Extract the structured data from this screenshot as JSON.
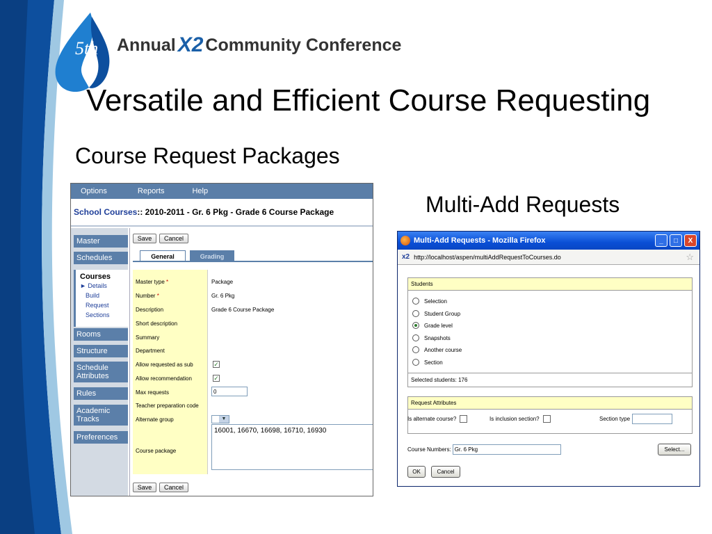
{
  "slide": {
    "logo_ordinal": "5th",
    "logo_text_left": "Annual",
    "logo_x2": "X2",
    "logo_text_right": "Community Conference",
    "title": "Versatile and Efficient Course Requesting",
    "left_heading": "Course Request Packages",
    "right_heading": "Multi-Add Requests"
  },
  "colors": {
    "nav_blue": "#5b7fa9",
    "label_yellow": "#ffffc4",
    "band_dark": "#0d4f9e",
    "band_light": "#9fc8e3"
  },
  "course_app": {
    "menu": [
      "Options",
      "Reports",
      "Help"
    ],
    "breadcrumb_link": "School Courses",
    "breadcrumb_rest": " :: 2010-2011 - Gr. 6 Pkg - Grade 6 Course Package",
    "nav": {
      "master": "Master",
      "schedules": "Schedules",
      "courses": "Courses",
      "courses_sub": [
        "► Details",
        "Build",
        "Request",
        "Sections"
      ],
      "rooms": "Rooms",
      "structure": "Structure",
      "schedule_attributes_1": "Schedule",
      "schedule_attributes_2": "Attributes",
      "rules": "Rules",
      "academic_tracks_1": "Academic",
      "academic_tracks_2": "Tracks",
      "preferences": "Preferences"
    },
    "save_label": "Save",
    "cancel_label": "Cancel",
    "tabs": [
      "General",
      "Grading"
    ],
    "fields": {
      "master_type_label": "Master type",
      "master_type_value": "Package",
      "number_label": "Number",
      "number_value": "Gr. 6 Pkg",
      "required_mark": "*",
      "description_label": "Description",
      "description_value": "Grade 6 Course Package",
      "short_description_label": "Short description",
      "summary_label": "Summary",
      "department_label": "Department",
      "allow_sub_label": "Allow requested as sub",
      "allow_recommendation_label": "Allow recommendation",
      "max_requests_label": "Max requests",
      "max_requests_value": "0",
      "teacher_prep_label": "Teacher preparation code",
      "alternate_group_label": "Alternate group",
      "course_package_label": "Course package",
      "course_package_value": "16001, 16670, 16698, 16710, 16930",
      "check_mark": "✓",
      "dropdown_arrow": "▼"
    }
  },
  "multi_add": {
    "window_title": "Multi-Add Requests - Mozilla Firefox",
    "minimize": "_",
    "maximize": "□",
    "close": "X",
    "url_badge": "x2",
    "url": "http://localhost/aspen/multiAddRequestToCourses.do",
    "bookmark_star": "☆",
    "students_header": "Students",
    "options": [
      "Selection",
      "Student Group",
      "Grade level",
      "Snapshots",
      "Another course",
      "Section"
    ],
    "selected_option": "Grade level",
    "selected_students_label": "Selected students:",
    "selected_students_count": "176",
    "request_attributes_header": "Request Attributes",
    "is_alternate_label": "Is alternate course?",
    "is_inclusion_label": "Is inclusion section?",
    "section_type_label": "Section type",
    "section_type_value": "",
    "course_numbers_label": "Course Numbers:",
    "course_numbers_value": "Gr. 6 Pkg",
    "select_label": "Select...",
    "ok_label": "OK",
    "cancel_label": "Cancel"
  }
}
